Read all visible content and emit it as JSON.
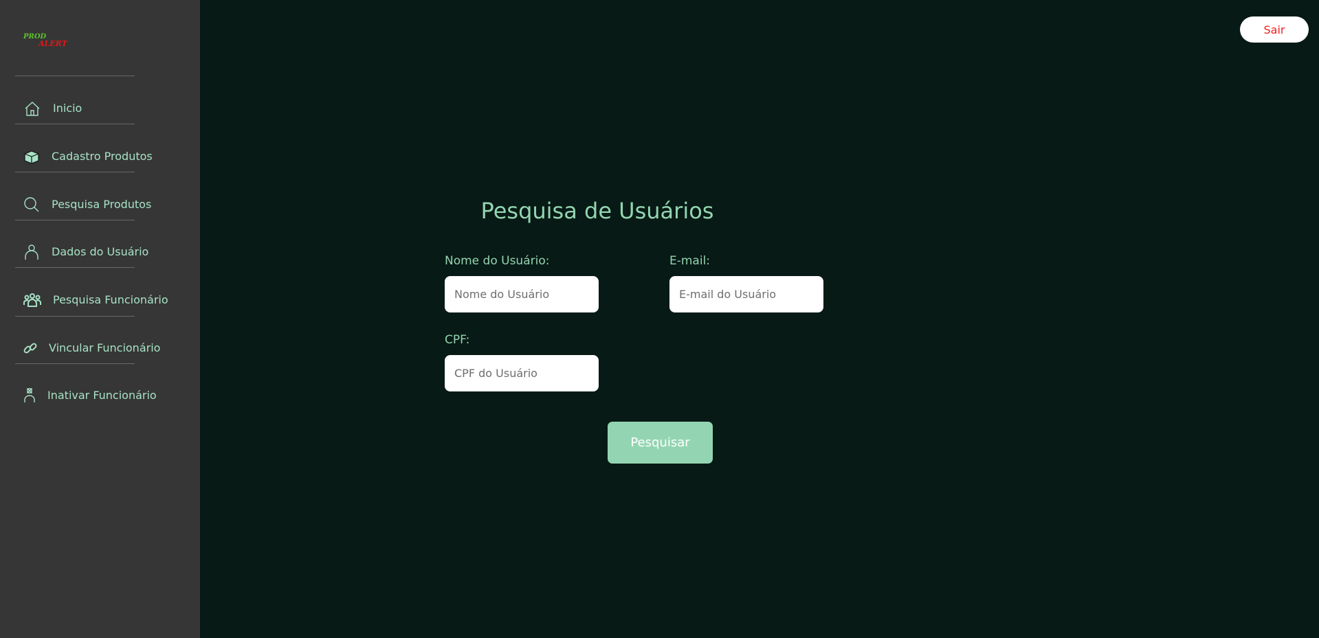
{
  "logo": {
    "line1": "PROD",
    "line2": "ALERT"
  },
  "sidebar": {
    "items": [
      {
        "label": "Inicio",
        "icon": "home-icon"
      },
      {
        "label": "Cadastro Produtos",
        "icon": "box-icon"
      },
      {
        "label": "Pesquisa Produtos",
        "icon": "search-icon"
      },
      {
        "label": "Dados do Usuário",
        "icon": "user-icon"
      },
      {
        "label": "Pesquisa Funcionário",
        "icon": "users-icon"
      },
      {
        "label": "Vincular Funcionário",
        "icon": "link-icon"
      },
      {
        "label": "Inativar Funcionário",
        "icon": "user-x-icon"
      }
    ]
  },
  "header": {
    "logout_label": "Sair",
    "logout_color": "#f01e1e"
  },
  "form": {
    "title": "Pesquisa de Usuários",
    "name_label": "Nome do Usuário:",
    "name_placeholder": "Nome do Usuário",
    "name_value": "",
    "email_label": "E-mail:",
    "email_placeholder": "E-mail do Usuário",
    "email_value": "",
    "cpf_label": "CPF:",
    "cpf_placeholder": "CPF do Usuário",
    "cpf_value": "",
    "submit_label": "Pesquisar"
  },
  "colors": {
    "accent": "#93d5b2",
    "background": "#081a15",
    "sidebar": "#363636"
  }
}
